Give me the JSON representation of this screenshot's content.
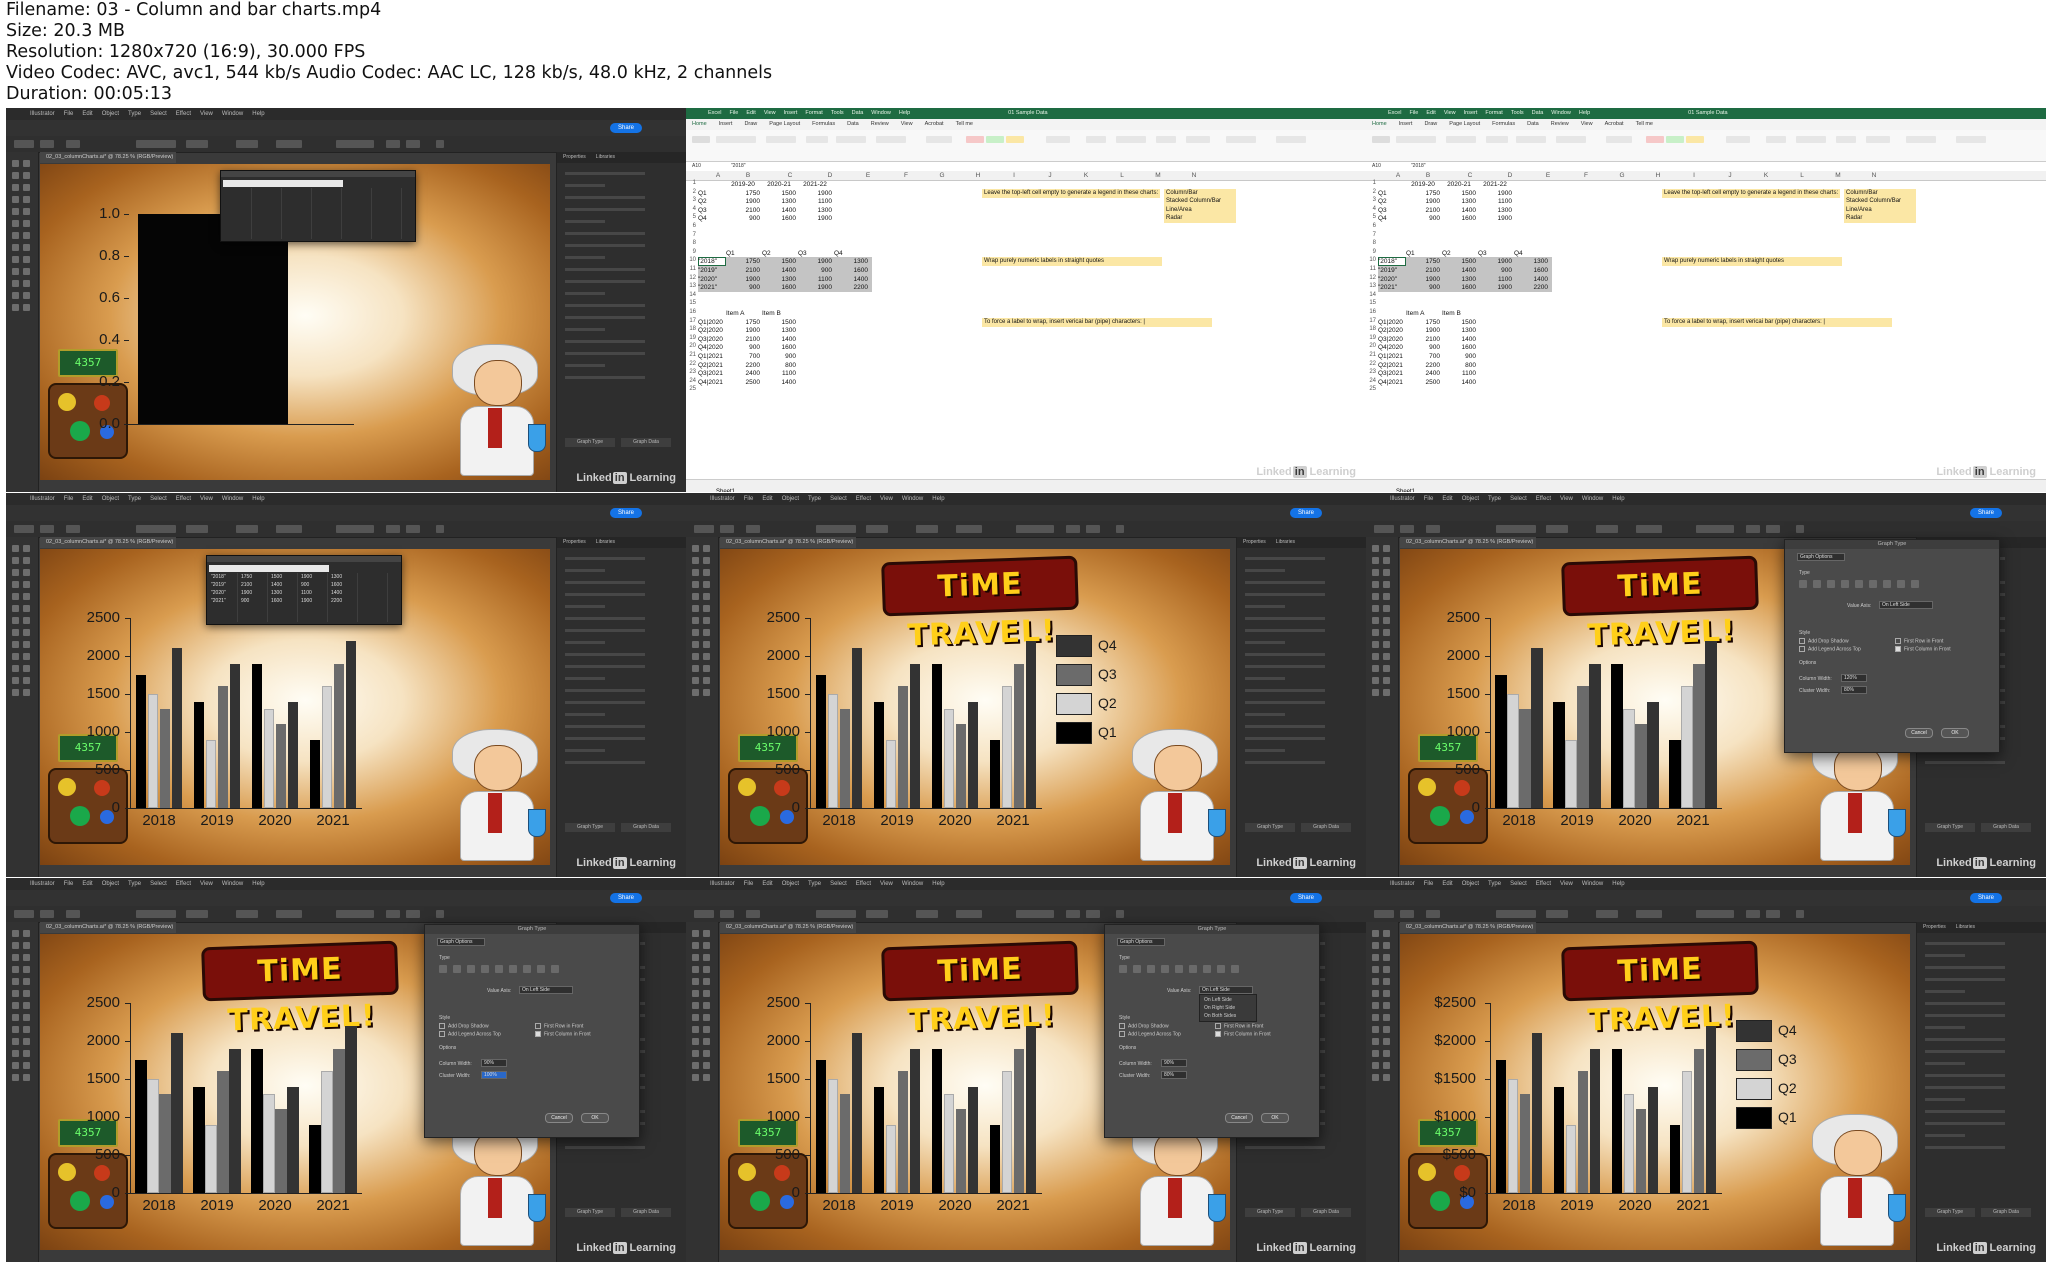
{
  "info": {
    "filename": "Filename: 03 - Column and bar charts.mp4",
    "size": "Size: 20.3 MB",
    "resolution": "Resolution: 1280x720 (16:9), 30.000 FPS",
    "codec": "Video Codec: AVC, avc1, 544 kb/s Audio Codec: AAC LC, 128 kb/s, 48.0 kHz, 2 channels",
    "duration": "Duration: 00:05:13"
  },
  "illustrator": {
    "app_title": "Adobe Illustrator 2022",
    "menu": [
      "Illustrator",
      "File",
      "Edit",
      "Object",
      "Type",
      "Select",
      "Effect",
      "View",
      "Window",
      "Help"
    ],
    "share_label": "Share",
    "doc_tab": "02_03_columnCharts.ai* @ 78.25 % (RGB/Preview)",
    "panel_tabs": [
      "Properties",
      "Libraries"
    ],
    "quick_actions": [
      "Graph Type",
      "Graph Data"
    ],
    "linkedin_text": "Linked",
    "linkedin_in": "in",
    "linkedin_suffix": "Learning"
  },
  "chart": {
    "title_art": "TiME TRAVEL!",
    "categories": [
      "2018",
      "2019",
      "2020",
      "2021"
    ],
    "series_names": [
      "Q1",
      "Q2",
      "Q3",
      "Q4"
    ],
    "series_colors": [
      "#000000",
      "#d4d4d4",
      "#6b6b6b",
      "#333333"
    ],
    "values": {
      "2018": [
        1750,
        1500,
        1300,
        2100
      ],
      "2019": [
        1400,
        900,
        1600,
        1900
      ],
      "2020": [
        1900,
        1300,
        1100,
        1400
      ],
      "2021": [
        900,
        1600,
        1900,
        2200
      ]
    },
    "ylim": [
      0,
      2500
    ],
    "y_ticks": [
      "2500",
      "2000",
      "1500",
      "1000",
      "500",
      "0"
    ],
    "y_ticks_dollar": [
      "$2500",
      "$2000",
      "$1500",
      "$1000",
      "$500",
      "$0"
    ],
    "first_thumb_y_ticks": [
      "1.0",
      "0.8",
      "0.6",
      "0.4",
      "0.2",
      "0.0"
    ],
    "legend": [
      "Q4",
      "Q3",
      "Q2",
      "Q1"
    ],
    "counter_display": "4357"
  },
  "dialog": {
    "title": "Graph Type",
    "section": "Graph Options",
    "type_label": "Type",
    "value_axis_label": "Value Axis:",
    "value_axis_value": "On Left Side",
    "value_axis_options": [
      "On Left Side",
      "On Right Side",
      "On Both Sides"
    ],
    "style_label": "Style",
    "add_drop_shadow": "Add Drop Shadow",
    "add_legend_top": "Add Legend Across Top",
    "first_row_front": "First Row in Front",
    "first_column_front": "First Column in Front",
    "options_label": "Options",
    "column_width_label": "Column Width:",
    "cluster_width_label": "Cluster Width:",
    "cw_values": [
      "90%",
      "120%",
      "90%"
    ],
    "clw_values": [
      "80%",
      "80%",
      "100%"
    ],
    "cancel": "Cancel",
    "ok": "OK"
  },
  "datasheet": {
    "rows": [
      [
        "\"2018\"",
        "1750",
        "1500",
        "1900",
        "1300"
      ],
      [
        "\"2019\"",
        "2100",
        "1400",
        "900",
        "1600"
      ],
      [
        "\"2020\"",
        "1900",
        "1300",
        "1100",
        "1400"
      ],
      [
        "\"2021\"",
        "900",
        "1600",
        "1900",
        "2200"
      ]
    ]
  },
  "excel": {
    "menu": [
      "Excel",
      "File",
      "Edit",
      "View",
      "Insert",
      "Format",
      "Tools",
      "Data",
      "Window",
      "Help"
    ],
    "file_title": "01 Sample Data",
    "ribbon_tabs": [
      "Home",
      "Insert",
      "Draw",
      "Page Layout",
      "Formulas",
      "Data",
      "Review",
      "View",
      "Acrobat",
      "Tell me"
    ],
    "name_box": "A10",
    "formula": "\"2018\"",
    "columns": [
      "A",
      "B",
      "C",
      "D",
      "E",
      "F",
      "G",
      "H",
      "I",
      "J",
      "K",
      "L",
      "M",
      "N"
    ],
    "row_numbers": [
      "1",
      "2",
      "3",
      "4",
      "5",
      "6",
      "7",
      "8",
      "9",
      "10",
      "11",
      "12",
      "13",
      "14",
      "15",
      "16",
      "17",
      "18",
      "19",
      "20",
      "21",
      "22",
      "23",
      "24",
      "25"
    ],
    "header_row": [
      "2019-20",
      "2020-21",
      "2021-22"
    ],
    "block1": [
      [
        "Q1",
        "1750",
        "1500",
        "1900"
      ],
      [
        "Q2",
        "1900",
        "1300",
        "1100"
      ],
      [
        "Q3",
        "2100",
        "1400",
        "1300"
      ],
      [
        "Q4",
        "900",
        "1600",
        "1900"
      ]
    ],
    "block2_header": [
      "Q1",
      "Q2",
      "Q3",
      "Q4"
    ],
    "block2": [
      [
        "\"2018\"",
        "1750",
        "1500",
        "1900",
        "1300"
      ],
      [
        "\"2019\"",
        "2100",
        "1400",
        "900",
        "1600"
      ],
      [
        "\"2020\"",
        "1900",
        "1300",
        "1100",
        "1400"
      ],
      [
        "\"2021\"",
        "900",
        "1600",
        "1900",
        "2200"
      ]
    ],
    "block3_header": [
      "Item A",
      "Item B"
    ],
    "block3": [
      [
        "Q1|2020",
        "1750",
        "1500"
      ],
      [
        "Q2|2020",
        "1900",
        "1300"
      ],
      [
        "Q3|2020",
        "2100",
        "1400"
      ],
      [
        "Q4|2020",
        "900",
        "1600"
      ],
      [
        "Q1|2021",
        "700",
        "900"
      ],
      [
        "Q2|2021",
        "2200",
        "800"
      ],
      [
        "Q3|2021",
        "2400",
        "1100"
      ],
      [
        "Q4|2021",
        "2500",
        "1400"
      ]
    ],
    "note1": "Leave the top-left cell empty to generate a legend in these charts:",
    "note1_list": [
      "Column/Bar",
      "Stacked Column/Bar",
      "Line/Area",
      "Radar"
    ],
    "note2": "Wrap purely numeric labels in straight quotes",
    "note3": "To force a label to wrap, insert vericai bar (pipe) characters: |",
    "sheet_tab": "Sheet1"
  }
}
